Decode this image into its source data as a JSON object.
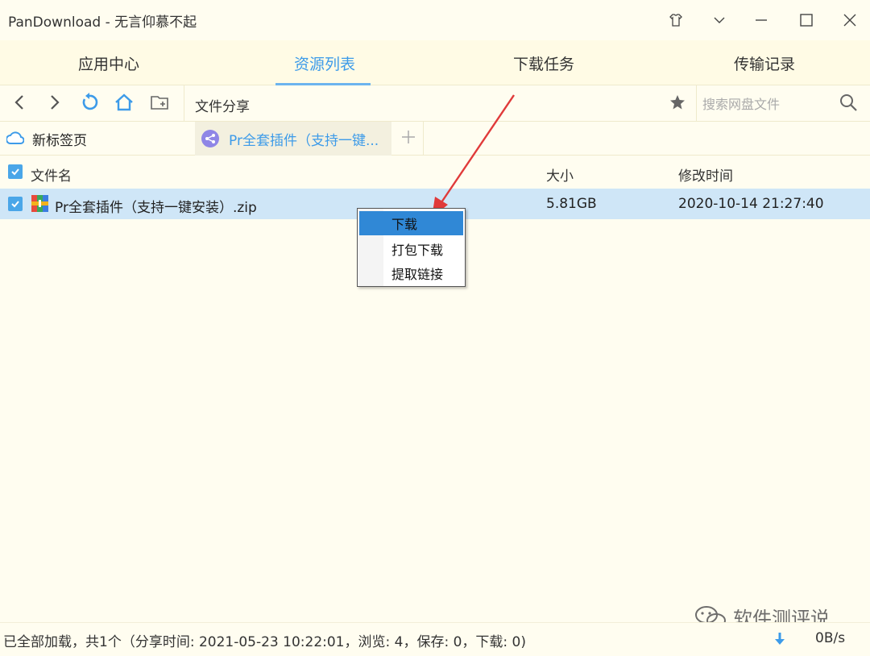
{
  "window": {
    "title": "PanDownload - 无言仰慕不起"
  },
  "main_tabs": [
    {
      "label": "应用中心"
    },
    {
      "label": "资源列表"
    },
    {
      "label": "下载任务"
    },
    {
      "label": "传输记录"
    }
  ],
  "active_main_tab": "资源列表",
  "toolbar": {
    "path": "文件分享",
    "search_placeholder": "搜索网盘文件"
  },
  "sub_tabs": [
    {
      "label": "新标签页"
    },
    {
      "label": "Pr全套插件（支持一键..."
    }
  ],
  "table": {
    "headers": {
      "name": "文件名",
      "size": "大小",
      "modified": "修改时间"
    },
    "rows": [
      {
        "name": "Pr全套插件（支持一键安装）.zip",
        "size": "5.81GB",
        "modified": "2020-10-14 21:27:40"
      }
    ]
  },
  "context_menu": {
    "items": [
      {
        "label": "下载"
      },
      {
        "label": "打包下载"
      },
      {
        "label": "提取链接"
      }
    ]
  },
  "status": {
    "text": "已全部加载，共1个（分享时间: 2021-05-23 10:22:01，浏览: 4，保存: 0，下载: 0)",
    "speed": "0B/s"
  },
  "watermark": {
    "text": "软件测评说"
  },
  "colors": {
    "accent": "#3d9be9",
    "background": "#fffdf0",
    "selected_row": "#cfe6f7",
    "menu_highlight": "#3088d6"
  }
}
